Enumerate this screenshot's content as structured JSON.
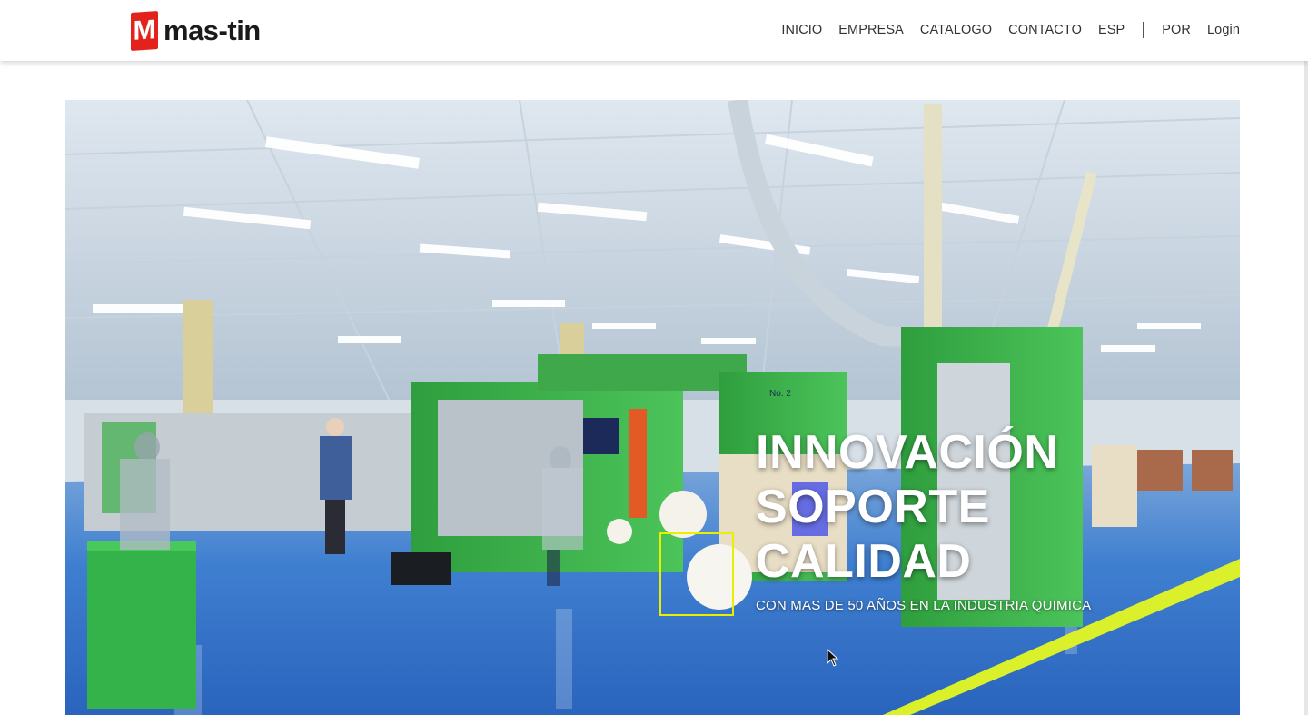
{
  "brand": {
    "logo_letter": "M",
    "name": "mas-tin",
    "accent": "#e3231b"
  },
  "nav": {
    "items": [
      {
        "label": "INICIO"
      },
      {
        "label": "EMPRESA"
      },
      {
        "label": "CATALOGO"
      },
      {
        "label": "CONTACTO"
      },
      {
        "label": "ESP"
      }
    ],
    "language_alt": "POR",
    "login": "Login"
  },
  "hero": {
    "title_lines": [
      "INNOVACIÓN",
      "SOPORTE",
      "CALIDAD"
    ],
    "subtitle": "CON MAS DE 50 AÑOS EN LA INDUSTRIA QUIMICA",
    "image": "factory-floor-image",
    "machine_tag": "No. 2"
  },
  "colors": {
    "floor": "#2f6fc4",
    "machine": "#3cb54a",
    "safety_line": "#d9f02a"
  }
}
